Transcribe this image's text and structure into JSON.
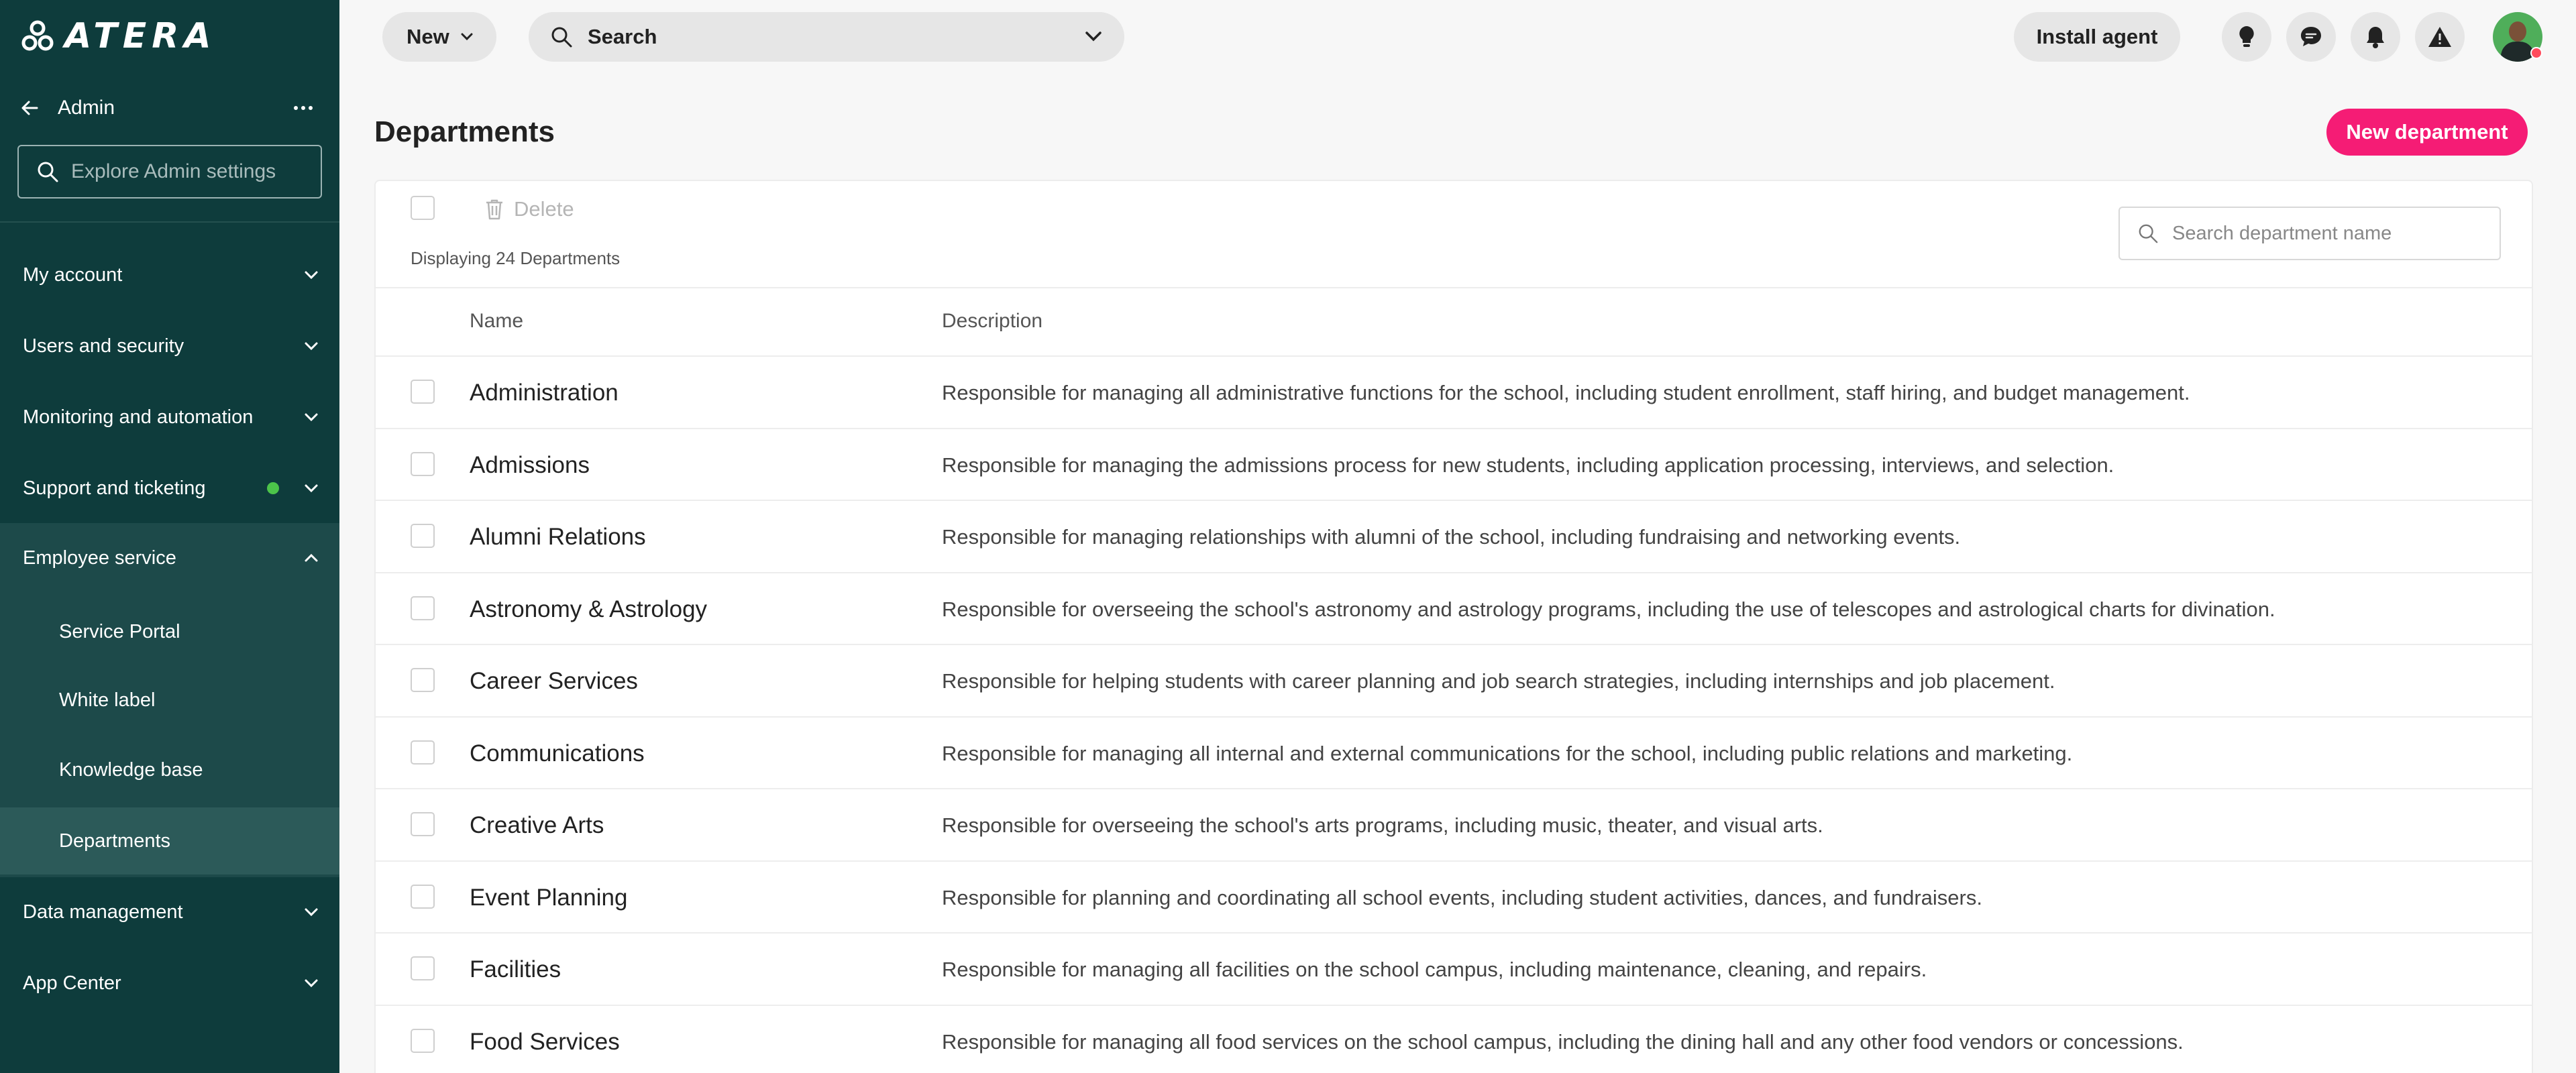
{
  "brand": {
    "name": "ATERA"
  },
  "sidebar": {
    "section_title": "Admin",
    "search_placeholder": "Explore Admin settings",
    "items": [
      {
        "label": "My account"
      },
      {
        "label": "Users and security"
      },
      {
        "label": "Monitoring and automation"
      },
      {
        "label": "Support and ticketing"
      },
      {
        "label": "Employee service"
      },
      {
        "label": "Data management"
      },
      {
        "label": "App Center"
      }
    ],
    "employee_service_items": [
      {
        "label": "Service Portal"
      },
      {
        "label": "White label"
      },
      {
        "label": "Knowledge base"
      },
      {
        "label": "Departments"
      }
    ],
    "status_dot_color": "#4cc44a"
  },
  "topbar": {
    "new_label": "New",
    "search_label": "Search",
    "install_label": "Install agent",
    "icons": [
      "lightbulb-icon",
      "chat-icon",
      "bell-icon",
      "warning-icon"
    ]
  },
  "page": {
    "title": "Departments",
    "new_button": "New department",
    "delete_label": "Delete",
    "displaying": "Displaying 24 Departments",
    "search_placeholder": "Search department name",
    "accent_color": "#f51c75"
  },
  "table": {
    "columns": {
      "name": "Name",
      "description": "Description"
    },
    "rows": [
      {
        "name": "Administration",
        "description": "Responsible for managing all administrative functions for the school, including student enrollment, staff hiring, and budget management."
      },
      {
        "name": "Admissions",
        "description": "Responsible for managing the admissions process for new students, including application processing, interviews, and selection."
      },
      {
        "name": "Alumni Relations",
        "description": "Responsible for managing relationships with alumni of the school, including fundraising and networking events."
      },
      {
        "name": "Astronomy & Astrology",
        "description": "Responsible for overseeing the school's astronomy and astrology programs, including the use of telescopes and astrological charts for divination."
      },
      {
        "name": "Career Services",
        "description": "Responsible for helping students with career planning and job search strategies, including internships and job placement."
      },
      {
        "name": "Communications",
        "description": "Responsible for managing all internal and external communications for the school, including public relations and marketing."
      },
      {
        "name": "Creative Arts",
        "description": "Responsible for overseeing the school's arts programs, including music, theater, and visual arts."
      },
      {
        "name": "Event Planning",
        "description": "Responsible for planning and coordinating all school events, including student activities, dances, and fundraisers."
      },
      {
        "name": "Facilities",
        "description": "Responsible for managing all facilities on the school campus, including maintenance, cleaning, and repairs."
      },
      {
        "name": "Food Services",
        "description": "Responsible for managing all food services on the school campus, including the dining hall and any other food vendors or concessions."
      }
    ]
  }
}
